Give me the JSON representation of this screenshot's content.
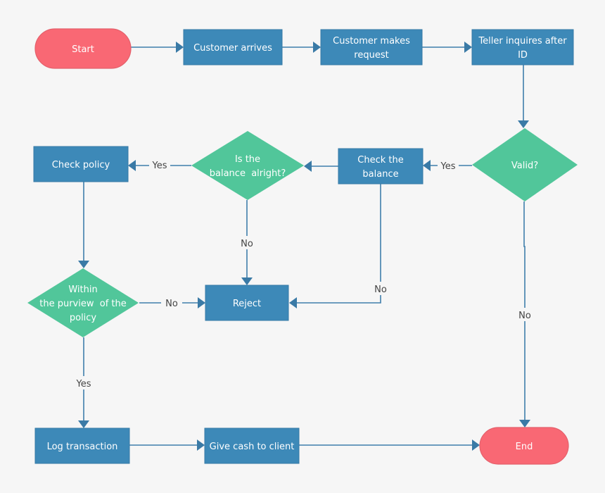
{
  "diagram": {
    "type": "flowchart",
    "title": "",
    "colors": {
      "background": "#f6f6f6",
      "terminal": "#f96874",
      "process": "#3d89b8",
      "decision": "#51c69a",
      "connector": "#3f7fab",
      "label_text": "#444444",
      "node_text": "#ffffff"
    },
    "nodes": [
      {
        "id": "start",
        "kind": "terminal",
        "lines": [
          "Start"
        ]
      },
      {
        "id": "customer_arrives",
        "kind": "process",
        "lines": [
          "Customer arrives"
        ]
      },
      {
        "id": "customer_request",
        "kind": "process",
        "lines": [
          "Customer makes",
          "request"
        ]
      },
      {
        "id": "teller_id",
        "kind": "process",
        "lines": [
          "Teller inquires after",
          "ID"
        ]
      },
      {
        "id": "valid",
        "kind": "decision",
        "lines": [
          "Valid?"
        ]
      },
      {
        "id": "check_balance",
        "kind": "process",
        "lines": [
          "Check the",
          "balance"
        ]
      },
      {
        "id": "balance_ok",
        "kind": "decision",
        "lines": [
          "Is the",
          "balance  alright?"
        ]
      },
      {
        "id": "check_policy",
        "kind": "process",
        "lines": [
          "Check policy"
        ]
      },
      {
        "id": "within_policy",
        "kind": "decision",
        "lines": [
          "Within",
          "the purview  of the",
          "policy"
        ]
      },
      {
        "id": "reject",
        "kind": "process",
        "lines": [
          "Reject"
        ]
      },
      {
        "id": "log_transaction",
        "kind": "process",
        "lines": [
          "Log transaction"
        ]
      },
      {
        "id": "give_cash",
        "kind": "process",
        "lines": [
          "Give cash to client"
        ]
      },
      {
        "id": "end",
        "kind": "terminal",
        "lines": [
          "End"
        ]
      }
    ],
    "edges": [
      {
        "from": "start",
        "to": "customer_arrives",
        "label": ""
      },
      {
        "from": "customer_arrives",
        "to": "customer_request",
        "label": ""
      },
      {
        "from": "customer_request",
        "to": "teller_id",
        "label": ""
      },
      {
        "from": "teller_id",
        "to": "valid",
        "label": ""
      },
      {
        "from": "valid",
        "to": "check_balance",
        "label": "Yes"
      },
      {
        "from": "valid",
        "to": "end",
        "label": "No"
      },
      {
        "from": "check_balance",
        "to": "balance_ok",
        "label": ""
      },
      {
        "from": "check_balance",
        "to": "reject",
        "label": "No"
      },
      {
        "from": "balance_ok",
        "to": "check_policy",
        "label": "Yes"
      },
      {
        "from": "balance_ok",
        "to": "reject",
        "label": "No"
      },
      {
        "from": "check_policy",
        "to": "within_policy",
        "label": ""
      },
      {
        "from": "within_policy",
        "to": "reject",
        "label": "No"
      },
      {
        "from": "within_policy",
        "to": "log_transaction",
        "label": "Yes"
      },
      {
        "from": "log_transaction",
        "to": "give_cash",
        "label": ""
      },
      {
        "from": "give_cash",
        "to": "end",
        "label": ""
      }
    ]
  }
}
